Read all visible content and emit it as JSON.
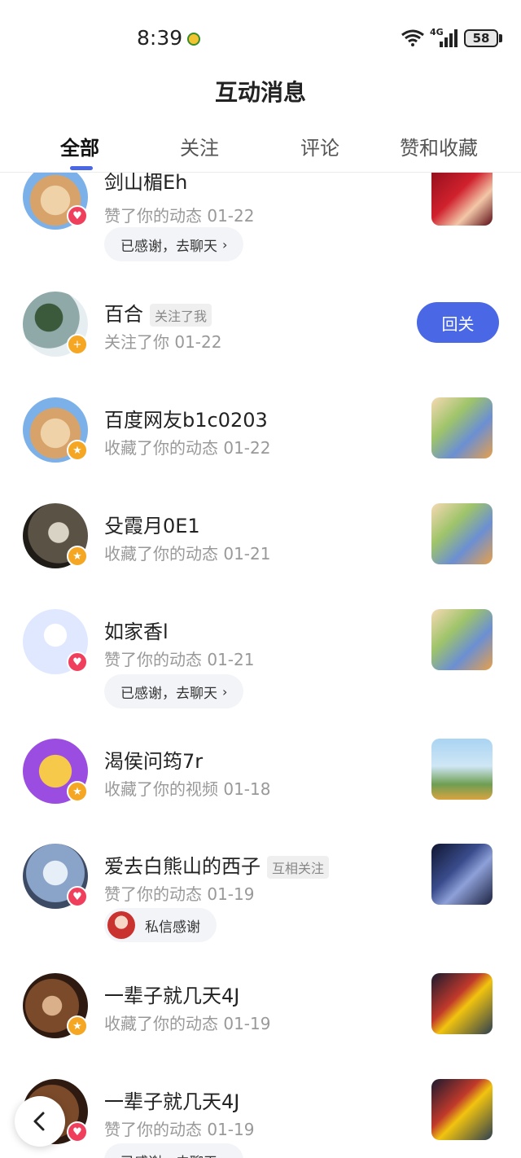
{
  "status_bar": {
    "time": "8:39",
    "network": "4G",
    "battery": "58"
  },
  "header": {
    "title": "互动消息"
  },
  "tabs": [
    {
      "label": "全部",
      "active": true
    },
    {
      "label": "关注",
      "active": false
    },
    {
      "label": "评论",
      "active": false
    },
    {
      "label": "赞和收藏",
      "active": false
    }
  ],
  "colors": {
    "accent": "#4a68e6",
    "like_badge": "#ef3f5c",
    "favorite_badge": "#f5a623"
  },
  "items": [
    {
      "name": "剑山楣Eh",
      "action": "赞了你的动态 01-22",
      "badge": "like-icon",
      "pill": "已感谢，去聊天"
    },
    {
      "name": "百合",
      "tag": "关注了我",
      "action": "关注了你 01-22",
      "badge": "follow-icon",
      "button": "回关"
    },
    {
      "name": "百度网友b1c0203",
      "action": "收藏了你的动态 01-22",
      "badge": "star-icon"
    },
    {
      "name": "殳霞月0E1",
      "action": "收藏了你的动态 01-21",
      "badge": "star-icon"
    },
    {
      "name": "如家香l",
      "action": "赞了你的动态 01-21",
      "badge": "like-icon",
      "pill": "已感谢，去聊天"
    },
    {
      "name": "渴侯问筠7r",
      "action": "收藏了你的视频 01-18",
      "badge": "star-icon"
    },
    {
      "name": "爱去白熊山的西子",
      "tag": "互相关注",
      "action": "赞了你的动态 01-19",
      "badge": "like-icon",
      "pill": "私信感谢"
    },
    {
      "name": "一辈子就几天4J",
      "action": "收藏了你的动态 01-19",
      "badge": "star-icon"
    },
    {
      "name": "一辈子就几天4J",
      "action": "赞了你的动态 01-19",
      "badge": "like-icon",
      "pill": "已感谢，去聊天"
    }
  ]
}
